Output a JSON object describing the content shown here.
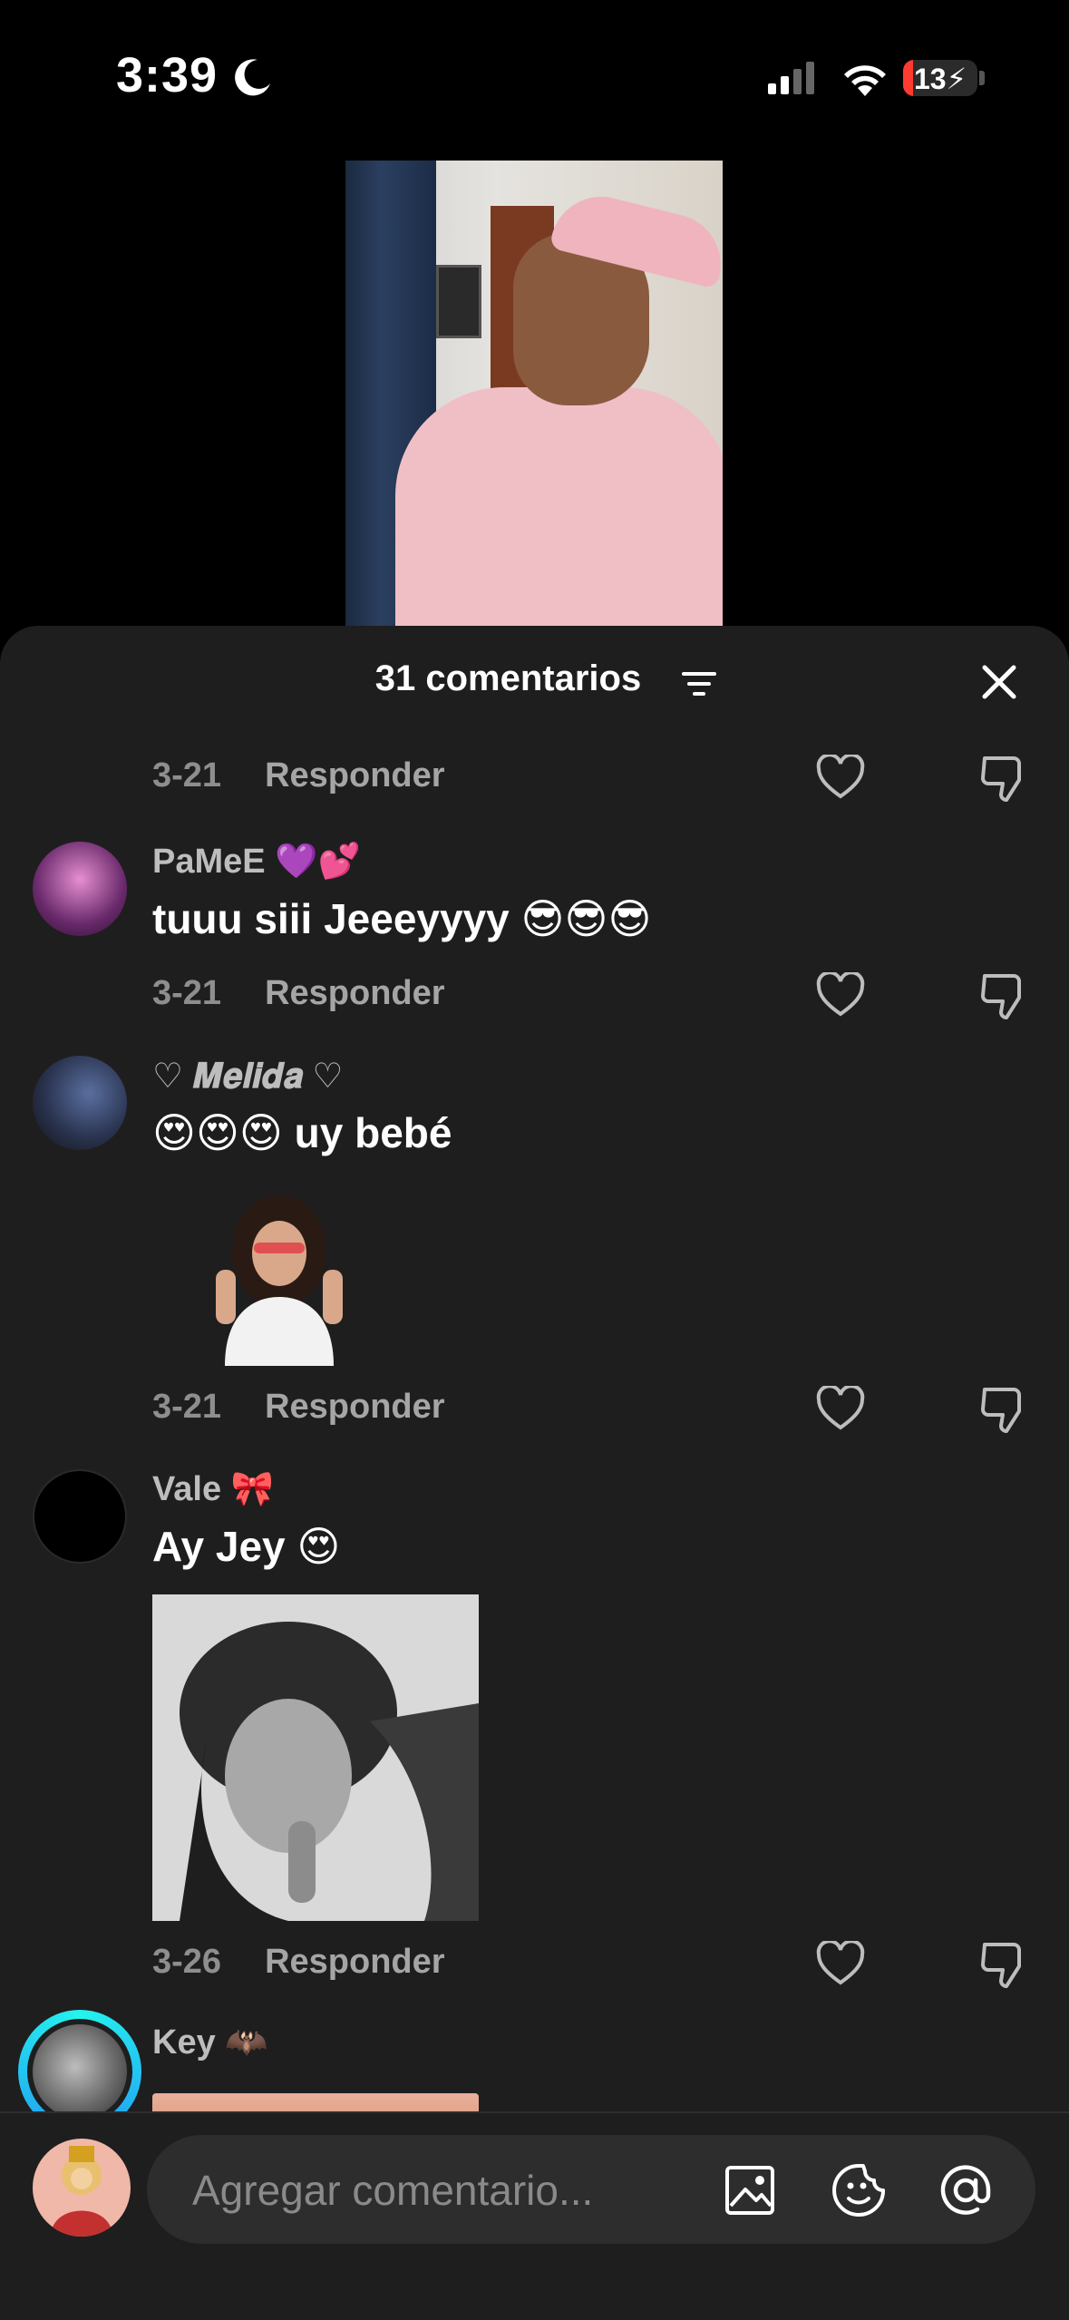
{
  "status_bar": {
    "time": "3:39",
    "battery": "13",
    "battery_level": 0.13
  },
  "sheet": {
    "title": "31 comentarios"
  },
  "comments": [
    {
      "date": "3-21",
      "reply": "Responder"
    },
    {
      "username": "PaMeE 💜💕",
      "text": "tuuu siii Jeeeyyyy 😎😎😎",
      "date": "3-21",
      "reply": "Responder"
    },
    {
      "username": "♡ 𝑴𝒆𝒍𝒊𝒅𝒂 ♡",
      "text": "😍😍😍 uy bebé",
      "date": "3-21",
      "reply": "Responder"
    },
    {
      "username": "Vale 🎀",
      "text": "Ay Jey 😍",
      "date": "3-26",
      "reply": "Responder"
    },
    {
      "username": "Key 🦇"
    }
  ],
  "input": {
    "placeholder": "Agregar comentario..."
  },
  "icons": [
    "moon-icon",
    "signal-icon",
    "wifi-icon",
    "filter-icon",
    "close-icon",
    "heart-icon",
    "dislike-icon",
    "image-icon",
    "sticker-icon",
    "mention-icon"
  ]
}
